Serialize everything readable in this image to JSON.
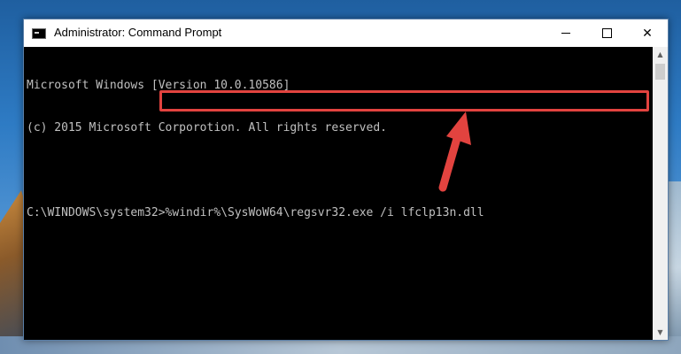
{
  "window": {
    "title": "Administrator: Command Prompt",
    "controls": {
      "minimize": "—",
      "maximize": "☐",
      "close": "✕"
    }
  },
  "console": {
    "lines": [
      "Microsoft Windows [Version 10.0.10586]",
      "(c) 2015 Microsoft Corporotion. All rights reserved.",
      "",
      "C:\\WINDOWS\\system32>%windir%\\SysWoW64\\regsvr32.exe /i lfclp13n.dll"
    ],
    "prompt": "C:\\WINDOWS\\system32>",
    "command": "%windir%\\SysWoW64\\regsvr32.exe /i lfclp13n.dll"
  },
  "scrollbar": {
    "up_icon": "▲",
    "down_icon": "▼"
  },
  "annotation": {
    "highlight_color": "#e2433f",
    "arrow_color": "#e2433f"
  }
}
